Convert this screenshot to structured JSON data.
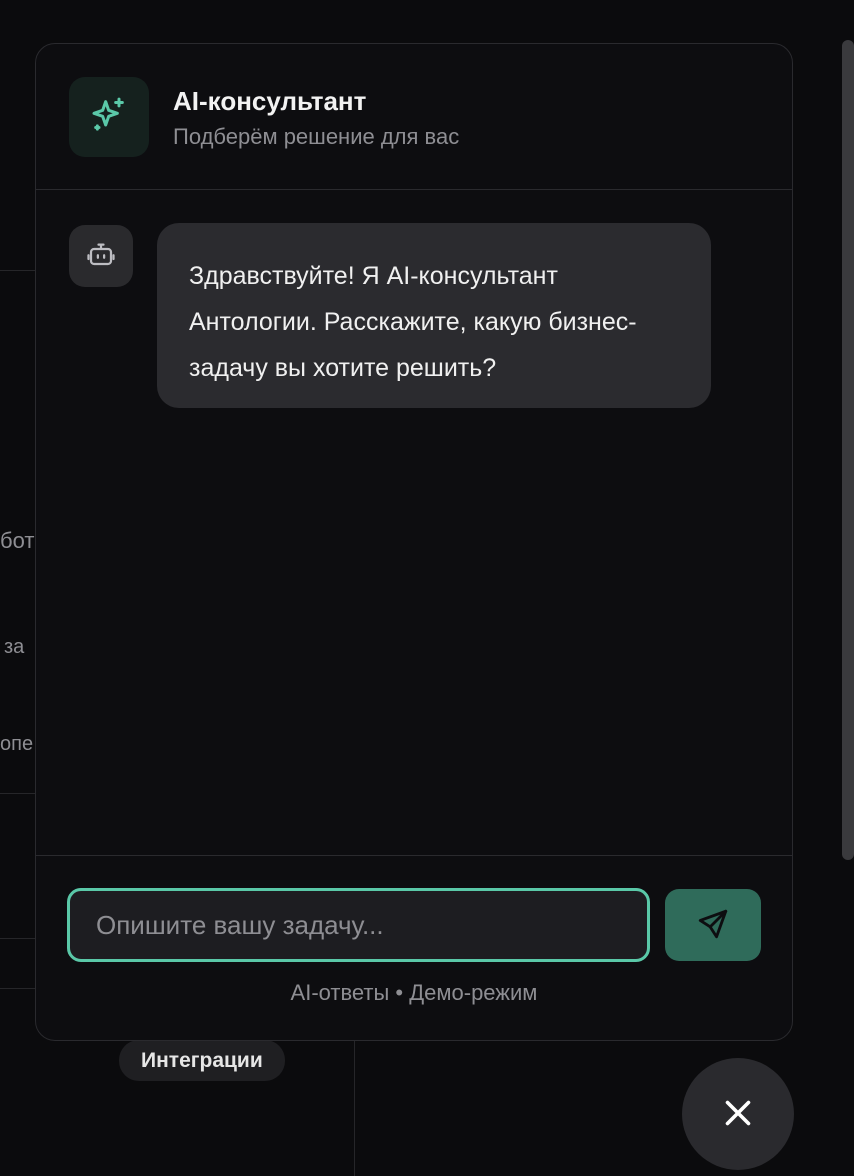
{
  "background": {
    "fragments": [
      "бот",
      "за",
      "опе"
    ],
    "tag": "Интеграции"
  },
  "header": {
    "title": "AI-консультант",
    "subtitle": "Подберём решение для вас",
    "icon": "sparkles-icon"
  },
  "messages": [
    {
      "role": "bot",
      "icon": "bot-icon",
      "text": "Здравствуйте! Я AI-консультант Антологии. Расскажите, какую бизнес-задачу вы хотите решить?"
    }
  ],
  "composer": {
    "placeholder": "Опишите вашу задачу...",
    "value": "",
    "send_icon": "send-icon"
  },
  "footer_note": "AI-ответы • Демо-режим",
  "close_icon": "close-icon",
  "colors": {
    "accent": "#5ac8a8",
    "send_button": "#2f6b5a",
    "bubble": "#2b2b2f"
  }
}
